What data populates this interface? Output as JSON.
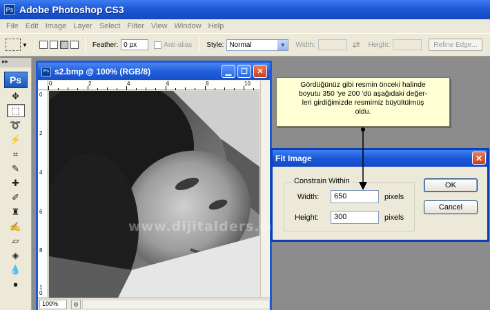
{
  "app": {
    "title": "Adobe Photoshop CS3",
    "logo": "Ps"
  },
  "menu": [
    "File",
    "Edit",
    "Image",
    "Layer",
    "Select",
    "Filter",
    "View",
    "Window",
    "Help"
  ],
  "options": {
    "feather_label": "Feather:",
    "feather_value": "0 px",
    "antialias_label": "Anti-alias",
    "style_label": "Style:",
    "style_value": "Normal",
    "width_label": "Width:",
    "height_label": "Height:",
    "refine_label": "Refine Edge..."
  },
  "toolbox": {
    "badge": "Ps",
    "header": "▸▸"
  },
  "document": {
    "title": "s2.bmp @ 100% (RGB/8)",
    "zoom": "100%",
    "ruler_h": [
      "0",
      "2",
      "4",
      "6",
      "8",
      "10"
    ],
    "ruler_v": [
      "0",
      "2",
      "4",
      "6",
      "8",
      "1",
      "0"
    ]
  },
  "watermark": "www.dijitalders.com",
  "callout": {
    "lines": [
      "Gördüğünüz gibi resmin önceki halinde",
      "boyutu 350 'ye 200 'dü aşağıdaki değer-",
      "leri girdiğimizde resmimiz büyültülmüş",
      "oldu."
    ]
  },
  "dialog": {
    "title": "Fit Image",
    "group_label": "Constrain Within",
    "width_label": "Width:",
    "width_value": "650",
    "width_unit": "pixels",
    "height_label": "Height:",
    "height_value": "300",
    "height_unit": "pixels",
    "ok_label": "OK",
    "cancel_label": "Cancel"
  },
  "colors": {
    "xp_blue": "#1d5ad6",
    "dialog_bg": "#ece9d8",
    "callout_bg": "#ffffd4"
  }
}
